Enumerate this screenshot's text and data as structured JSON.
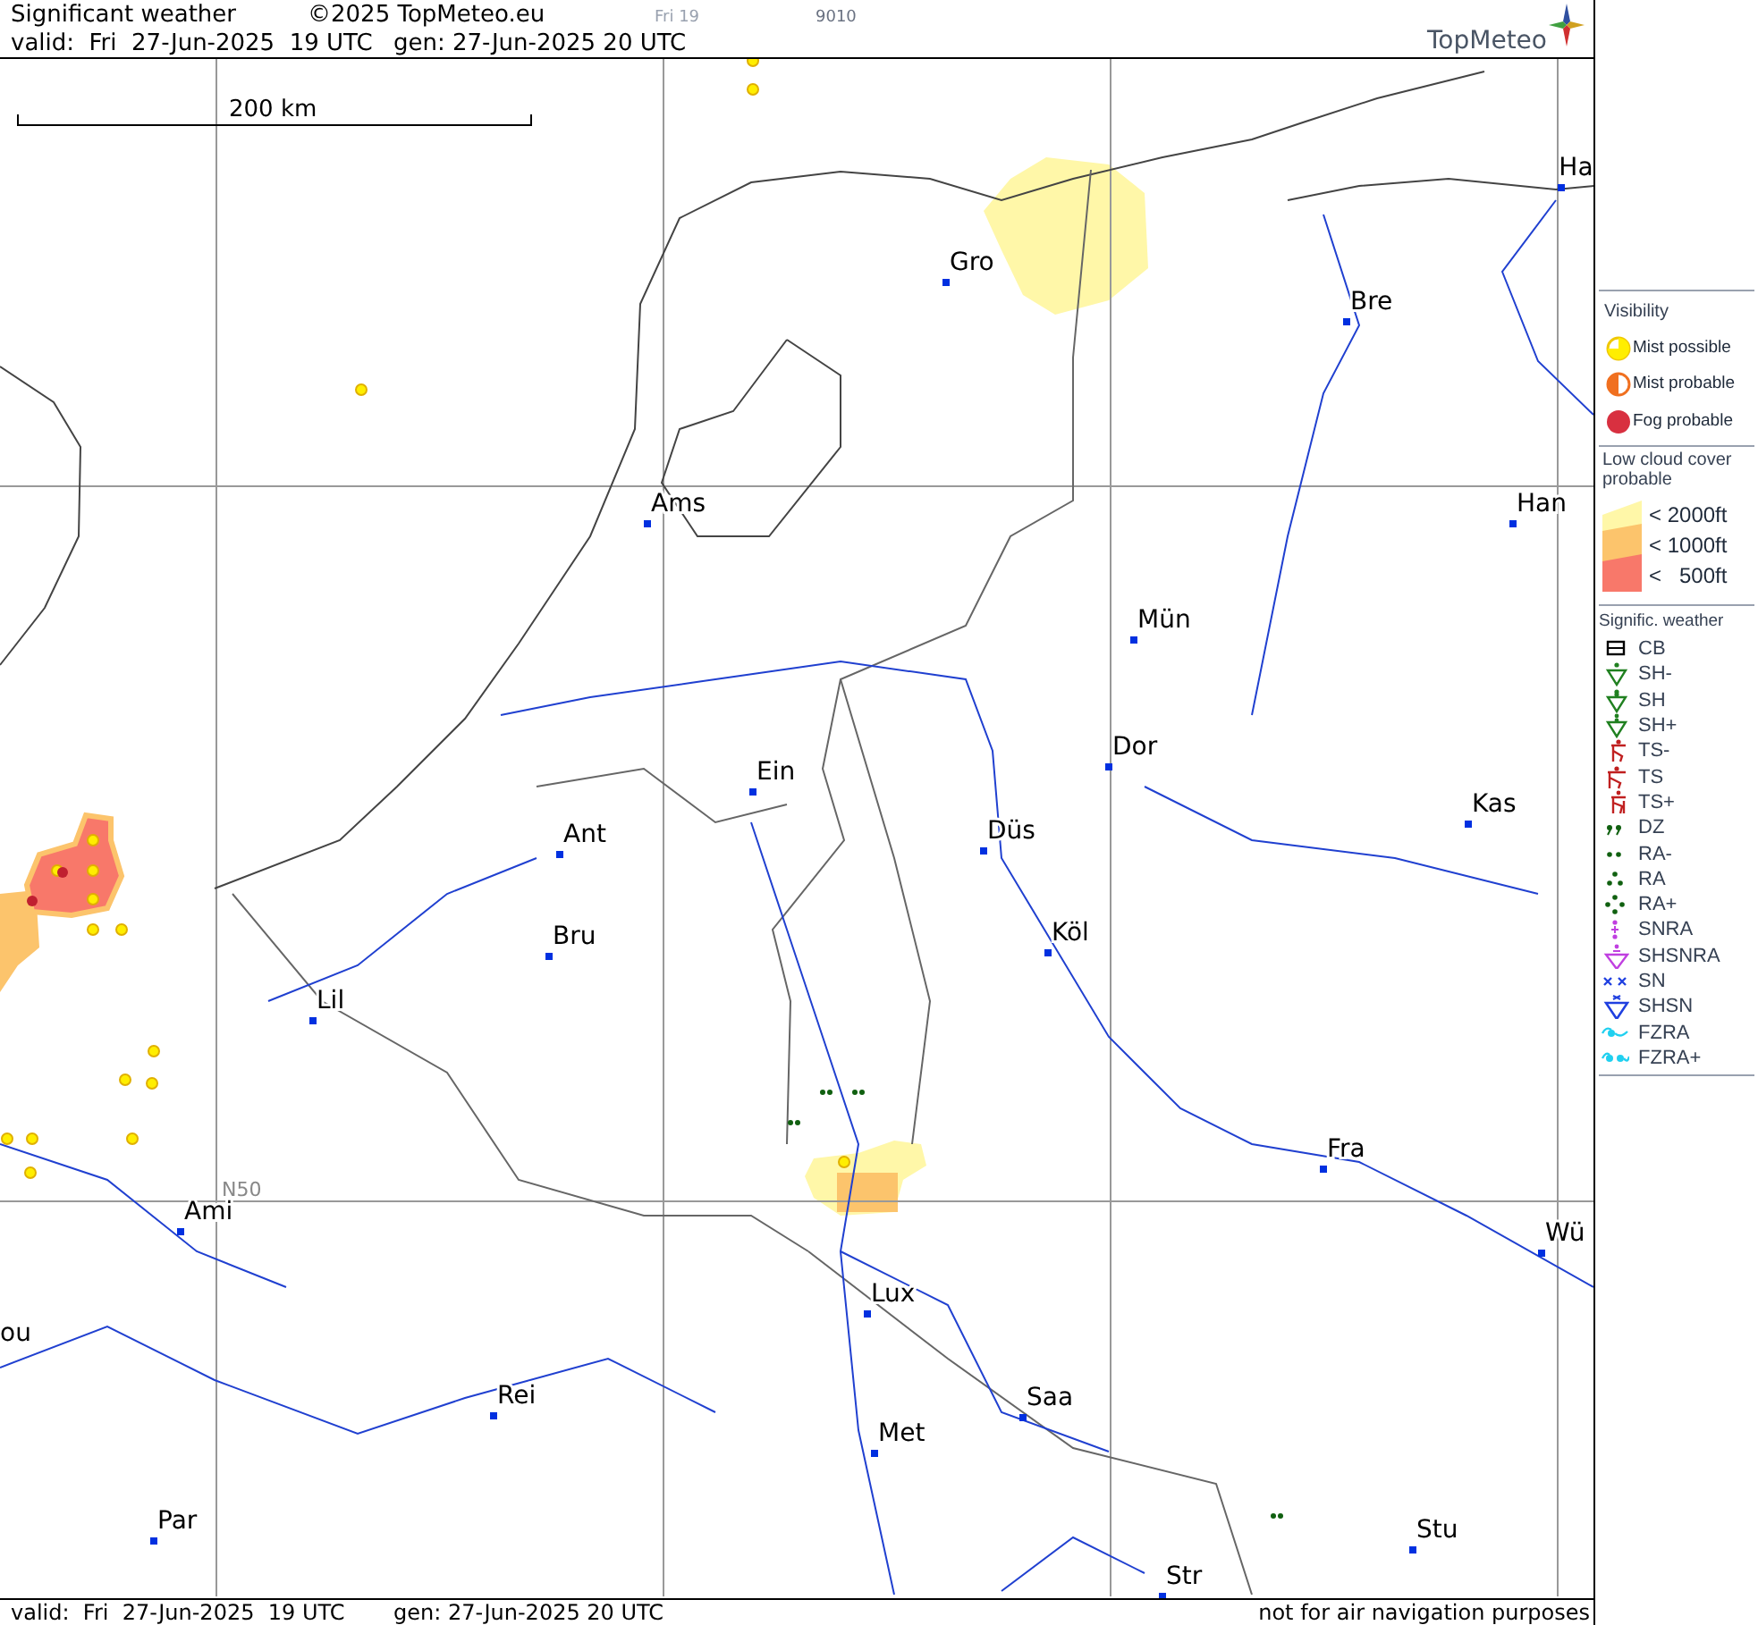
{
  "header": {
    "title": "Significant weather",
    "copyright": "©2025 TopMeteo.eu",
    "frame_label": "Fri 19",
    "code": "9010",
    "valid": "valid:  Fri  27-Jun-2025  19 UTC",
    "generated": "gen: 27-Jun-2025 20 UTC",
    "logo": "TopMeteo"
  },
  "map": {
    "scale_label": "200 km",
    "grid_label": "N50",
    "cities": [
      {
        "name": "Ha"
      },
      {
        "name": "Gro"
      },
      {
        "name": "Bre"
      },
      {
        "name": "Ams"
      },
      {
        "name": "Han"
      },
      {
        "name": "Mün"
      },
      {
        "name": "Dor"
      },
      {
        "name": "Ein"
      },
      {
        "name": "Kas"
      },
      {
        "name": "Düs"
      },
      {
        "name": "Ant"
      },
      {
        "name": "Köl"
      },
      {
        "name": "Bru"
      },
      {
        "name": "Lil"
      },
      {
        "name": "Fra"
      },
      {
        "name": "Ami"
      },
      {
        "name": "Wü"
      },
      {
        "name": "Lux"
      },
      {
        "name": "ou"
      },
      {
        "name": "Rei"
      },
      {
        "name": "Saa"
      },
      {
        "name": "Met"
      },
      {
        "name": "Par"
      },
      {
        "name": "Stu"
      },
      {
        "name": "Str"
      }
    ]
  },
  "legend": {
    "visibility_title": "Visibility",
    "visibility": [
      {
        "kind": "possible",
        "label": "Mist possible"
      },
      {
        "kind": "probable",
        "label": "Mist probable"
      },
      {
        "kind": "fog",
        "label": "Fog probable"
      }
    ],
    "cloud_title": "Low cloud cover probable",
    "cloud_levels": [
      {
        "label": "< 2000ft",
        "color": "#fff7a8"
      },
      {
        "label": "< 1000ft",
        "color": "#fcc46c"
      },
      {
        "label": "<   500ft",
        "color": "#f8786a"
      }
    ],
    "weather_title": "Signific. weather",
    "weather": [
      {
        "kind": "cb",
        "label": "CB"
      },
      {
        "kind": "shower1",
        "label": "SH-"
      },
      {
        "kind": "shower2",
        "label": "SH"
      },
      {
        "kind": "shower3",
        "label": "SH+"
      },
      {
        "kind": "thunder1",
        "label": "TS-"
      },
      {
        "kind": "thunder2",
        "label": "TS"
      },
      {
        "kind": "thunder3",
        "label": "TS+"
      },
      {
        "kind": "drizzle",
        "label": "DZ"
      },
      {
        "kind": "rain1",
        "label": "RA-"
      },
      {
        "kind": "rain2",
        "label": "RA"
      },
      {
        "kind": "rain3",
        "label": "RA+"
      },
      {
        "kind": "snowrain",
        "label": "SNRA"
      },
      {
        "kind": "snowrainshower",
        "label": "SHSNRA"
      },
      {
        "kind": "snow",
        "label": "SN"
      },
      {
        "kind": "snowshower",
        "label": "SHSN"
      },
      {
        "kind": "freezing1",
        "label": "FZRA"
      },
      {
        "kind": "freezing2",
        "label": "FZRA+"
      }
    ]
  },
  "footer": {
    "valid": "valid:  Fri  27-Jun-2025  19 UTC",
    "generated": "gen: 27-Jun-2025 20 UTC",
    "disclaimer": "not for air navigation purposes"
  }
}
